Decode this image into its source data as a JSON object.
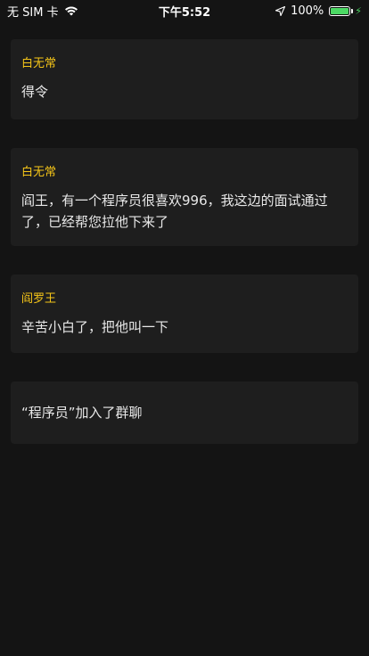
{
  "status_bar": {
    "carrier": "无 SIM 卡",
    "time": "下午5:52",
    "battery_percent": "100%",
    "battery_level": 1.0
  },
  "messages": [
    {
      "sender": "白无常",
      "text": "得令"
    },
    {
      "sender": "白无常",
      "text": "阎王，有一个程序员很喜欢996，我这边的面试通过了，已经帮您拉他下来了"
    },
    {
      "sender": "阎罗王",
      "text": "辛苦小白了，把他叫一下"
    }
  ],
  "system_notice": "“程序员”加入了群聊",
  "colors": {
    "background": "#141414",
    "card": "#1e1e1e",
    "sender": "#f5c518",
    "battery": "#4cd964"
  }
}
